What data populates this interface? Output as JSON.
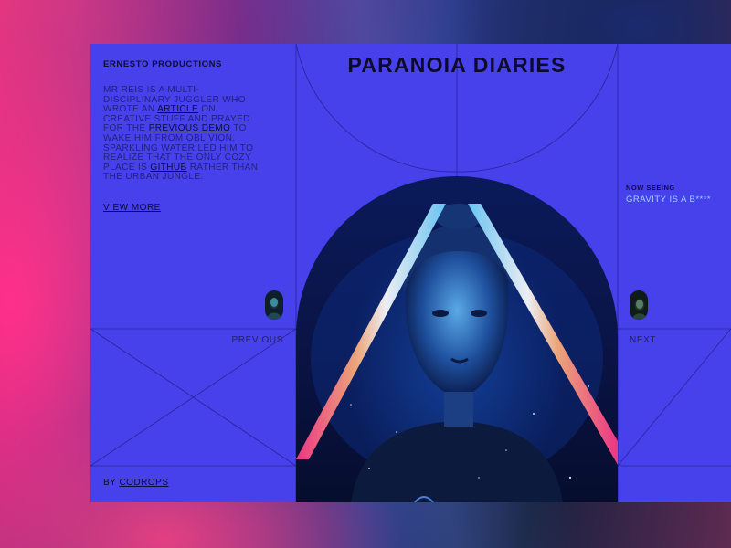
{
  "brand": "ERNESTO PRODUCTIONS",
  "intro": {
    "part1": "MR REIS IS A MULTI-DISCIPLINARY JUGGLER WHO WROTE AN ",
    "link_article": "ARTICLE",
    "part2": " ON CREATIVE STUFF AND PRAYED FOR THE ",
    "link_previous_demo": "PREVIOUS DEMO",
    "part3": " TO WAKE HIM FROM OBLIVION. SPARKLING WATER LED HIM TO REALIZE THAT THE ONLY COZY PLACE IS ",
    "link_github": "GITHUB",
    "part4": " RATHER THAN THE URBAN JUNGLE."
  },
  "view_more": "VIEW MORE",
  "title": "PARANOIA DIARIES",
  "now_seeing": {
    "label": "NOW SEEING",
    "value": "GRAVITY IS A B****"
  },
  "nav": {
    "previous": "PREVIOUS",
    "next": "NEXT"
  },
  "footer": {
    "by": "BY ",
    "link": "CODROPS"
  },
  "colors": {
    "panel": "#4641ea",
    "accent_text": "#9fd3ff",
    "dark_text": "#0f0c3a",
    "background_pink": "#e0317c",
    "background_navy": "#17213f"
  },
  "icons": {
    "thumb_prev": "portrait-thumbnail",
    "thumb_next": "portrait-thumbnail"
  }
}
